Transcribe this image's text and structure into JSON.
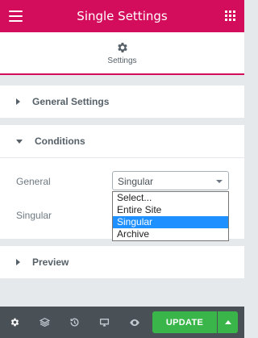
{
  "header": {
    "title": "Single Settings",
    "menu_icon": "hamburger-icon",
    "apps_icon": "grid-icon"
  },
  "tab": {
    "label": "Settings",
    "icon": "gear-icon"
  },
  "sections": {
    "general_settings": {
      "label": "General Settings",
      "expanded": false
    },
    "conditions": {
      "label": "Conditions",
      "expanded": true,
      "general_label": "General",
      "general_value": "Singular",
      "singular_label": "Singular",
      "options": [
        "Select...",
        "Entire Site",
        "Singular",
        "Archive"
      ],
      "selected_option": "Singular"
    },
    "preview": {
      "label": "Preview",
      "expanded": false
    }
  },
  "footer": {
    "update_label": "UPDATE",
    "icons": [
      "gear-icon",
      "layers-icon",
      "history-icon",
      "responsive-icon",
      "eye-icon"
    ]
  },
  "colors": {
    "brand": "#d30c5c",
    "footer": "#495157",
    "update": "#39b54a",
    "highlight": "#1e90ff"
  }
}
